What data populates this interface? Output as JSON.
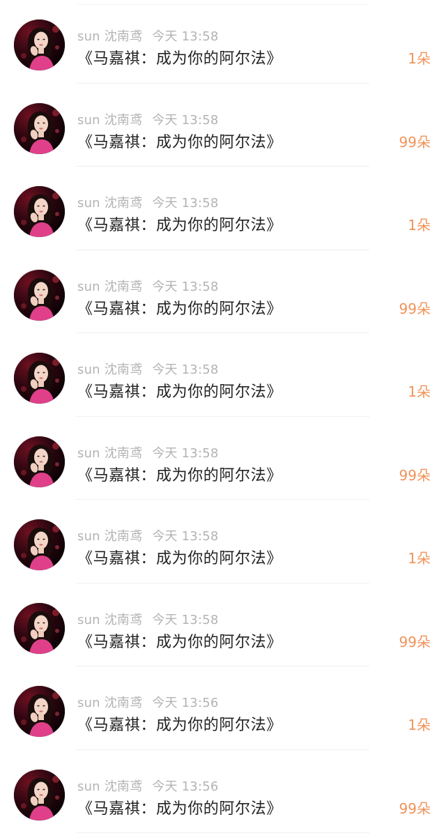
{
  "items": [
    {
      "user": "sun 沈南鸢",
      "time": "今天 13:58",
      "title": "《马嘉祺：成为你的阿尔法》",
      "count": "1朵"
    },
    {
      "user": "sun 沈南鸢",
      "time": "今天 13:58",
      "title": "《马嘉祺：成为你的阿尔法》",
      "count": "99朵"
    },
    {
      "user": "sun 沈南鸢",
      "time": "今天 13:58",
      "title": "《马嘉祺：成为你的阿尔法》",
      "count": "1朵"
    },
    {
      "user": "sun 沈南鸢",
      "time": "今天 13:58",
      "title": "《马嘉祺：成为你的阿尔法》",
      "count": "99朵"
    },
    {
      "user": "sun 沈南鸢",
      "time": "今天 13:58",
      "title": "《马嘉祺：成为你的阿尔法》",
      "count": "1朵"
    },
    {
      "user": "sun 沈南鸢",
      "time": "今天 13:58",
      "title": "《马嘉祺：成为你的阿尔法》",
      "count": "99朵"
    },
    {
      "user": "sun 沈南鸢",
      "time": "今天 13:58",
      "title": "《马嘉祺：成为你的阿尔法》",
      "count": "1朵"
    },
    {
      "user": "sun 沈南鸢",
      "time": "今天 13:58",
      "title": "《马嘉祺：成为你的阿尔法》",
      "count": "99朵"
    },
    {
      "user": "sun 沈南鸢",
      "time": "今天 13:56",
      "title": "《马嘉祺：成为你的阿尔法》",
      "count": "1朵"
    },
    {
      "user": "sun 沈南鸢",
      "time": "今天 13:56",
      "title": "《马嘉祺：成为你的阿尔法》",
      "count": "99朵"
    }
  ]
}
